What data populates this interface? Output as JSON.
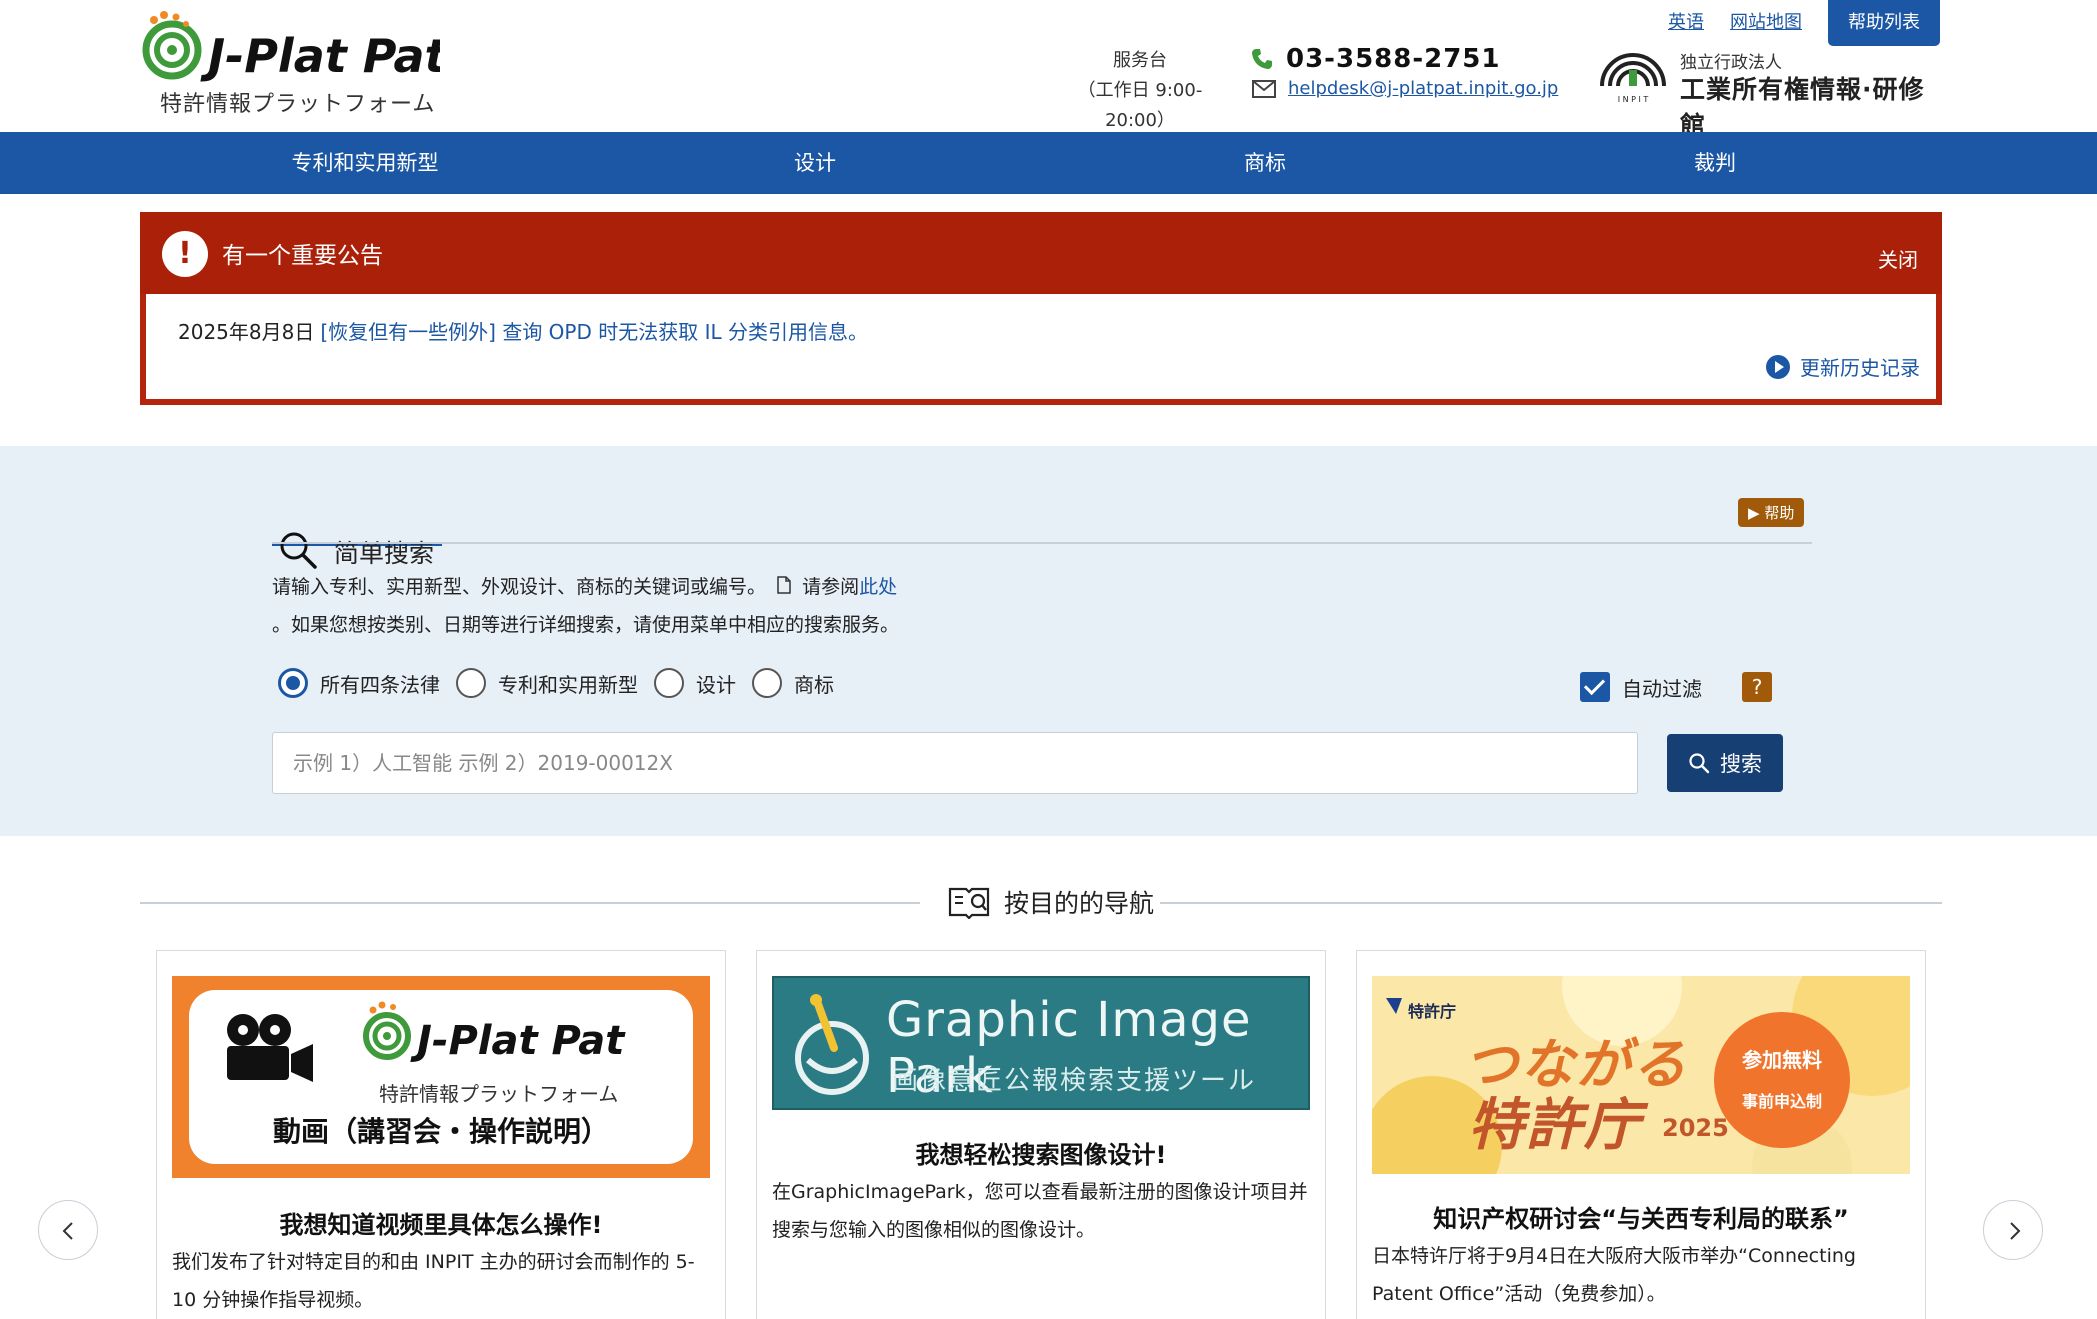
{
  "header": {
    "logo_subtitle": "特許情報プラットフォーム",
    "top_links": [
      "英语",
      "网站地图"
    ],
    "help_list": "帮助列表",
    "helpdesk_label": "服务台",
    "helpdesk_hours": "（工作日 9:00-20:00）",
    "phone": "03-3588-2751",
    "email": "helpdesk@j-platpat.inpit.go.jp",
    "inpit_small": "独立行政法人",
    "inpit_big": "工業所有権情報·研修館",
    "inpit_letters": "I N P I T"
  },
  "nav": [
    "专利和实用新型",
    "设计",
    "商标",
    "裁判"
  ],
  "notice": {
    "title": "有一个重要公告",
    "close": "关闭",
    "date": "2025年8月8日",
    "link": "[恢复但有一些例外] 查询 OPD 时无法获取 IL 分类引用信息。",
    "history": "更新历史记录"
  },
  "search": {
    "tab_label": "简单搜索",
    "help": "帮助",
    "desc_part1": "请输入专利、实用新型、外观设计、商标的关键词或编号。",
    "desc_see": "请参阅",
    "desc_link": "此处",
    "desc_line2": "。如果您想按类别、日期等进行详细搜索，请使用菜单中相应的搜索服务。",
    "radios": [
      "所有四条法律",
      "专利和实用新型",
      "设计",
      "商标"
    ],
    "autofilter": "自动过滤",
    "qmark": "?",
    "placeholder": "示例 1）人工智能 示例 2）2019-00012X",
    "button": "搜索"
  },
  "purpose": {
    "title": "按目的的导航",
    "cards": [
      {
        "banner_sub": "特許情報プラットフォーム",
        "banner_text": "動画（講習会・操作説明）",
        "title": "我想知道视频里具体怎么操作!",
        "desc": "我们发布了针对特定目的和由 INPIT 主办的研讨会而制作的 5-10 分钟操作指导视频。"
      },
      {
        "banner_title": "Graphic Image Park",
        "banner_sub": "画像意匠公報検索支援ツール",
        "title": "我想轻松搜索图像设计!",
        "desc": "在GraphicImagePark，您可以查看最新注册的图像设计项目并搜索与您输入的图像相似的图像设计。"
      },
      {
        "banner_org": "特許庁",
        "banner_line1": "つながる",
        "banner_line2": "特許庁",
        "banner_year": "2025",
        "banner_badge1": "参加無料",
        "banner_badge2": "事前申込制",
        "title": "知识产权研讨会“与关西专利局的联系”",
        "desc": "日本特许厅将于9月4日在大阪府大阪市举办“Connecting Patent Office”活动（免费参加）。"
      }
    ]
  },
  "colors": {
    "primary": "#1c57a5",
    "alert": "#aa2009",
    "help": "#a05a09",
    "search_bg": "#e7eff7",
    "logo_green": "#3e9a3a",
    "logo_orange": "#f08a24"
  }
}
